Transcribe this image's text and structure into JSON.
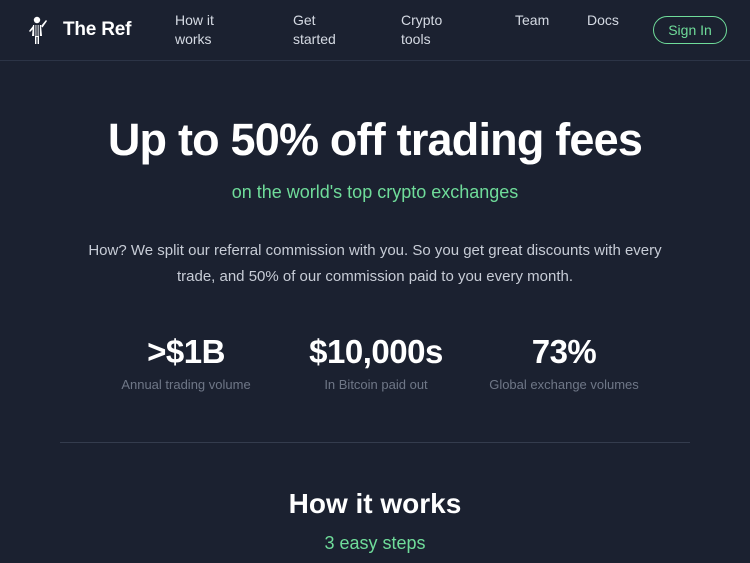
{
  "header": {
    "brand": "The Ref",
    "nav": [
      {
        "line1": "How it",
        "line2": "works"
      },
      {
        "line1": "Get",
        "line2": "started"
      },
      {
        "line1": "Crypto",
        "line2": "tools"
      },
      {
        "line1": "Team",
        "line2": ""
      },
      {
        "line1": "Docs",
        "line2": ""
      }
    ],
    "signin_label": "Sign In",
    "logo_icon": "referee-logo-icon"
  },
  "hero": {
    "title": "Up to 50% off trading fees",
    "subtitle": "on the world's top crypto exchanges",
    "description": "How? We split our referral commission with you. So you get great discounts with every trade, and 50% of our commission paid to you every month."
  },
  "stats": [
    {
      "value": ">$1B",
      "label": "Annual trading volume"
    },
    {
      "value": "$10,000s",
      "label": "In Bitcoin paid out"
    },
    {
      "value": "73%",
      "label": "Global exchange volumes"
    }
  ],
  "how_it_works": {
    "title": "How it works",
    "subtitle": "3 easy steps"
  },
  "colors": {
    "background": "#1b2130",
    "accent": "#6fdc9a",
    "muted": "#6f7787"
  }
}
